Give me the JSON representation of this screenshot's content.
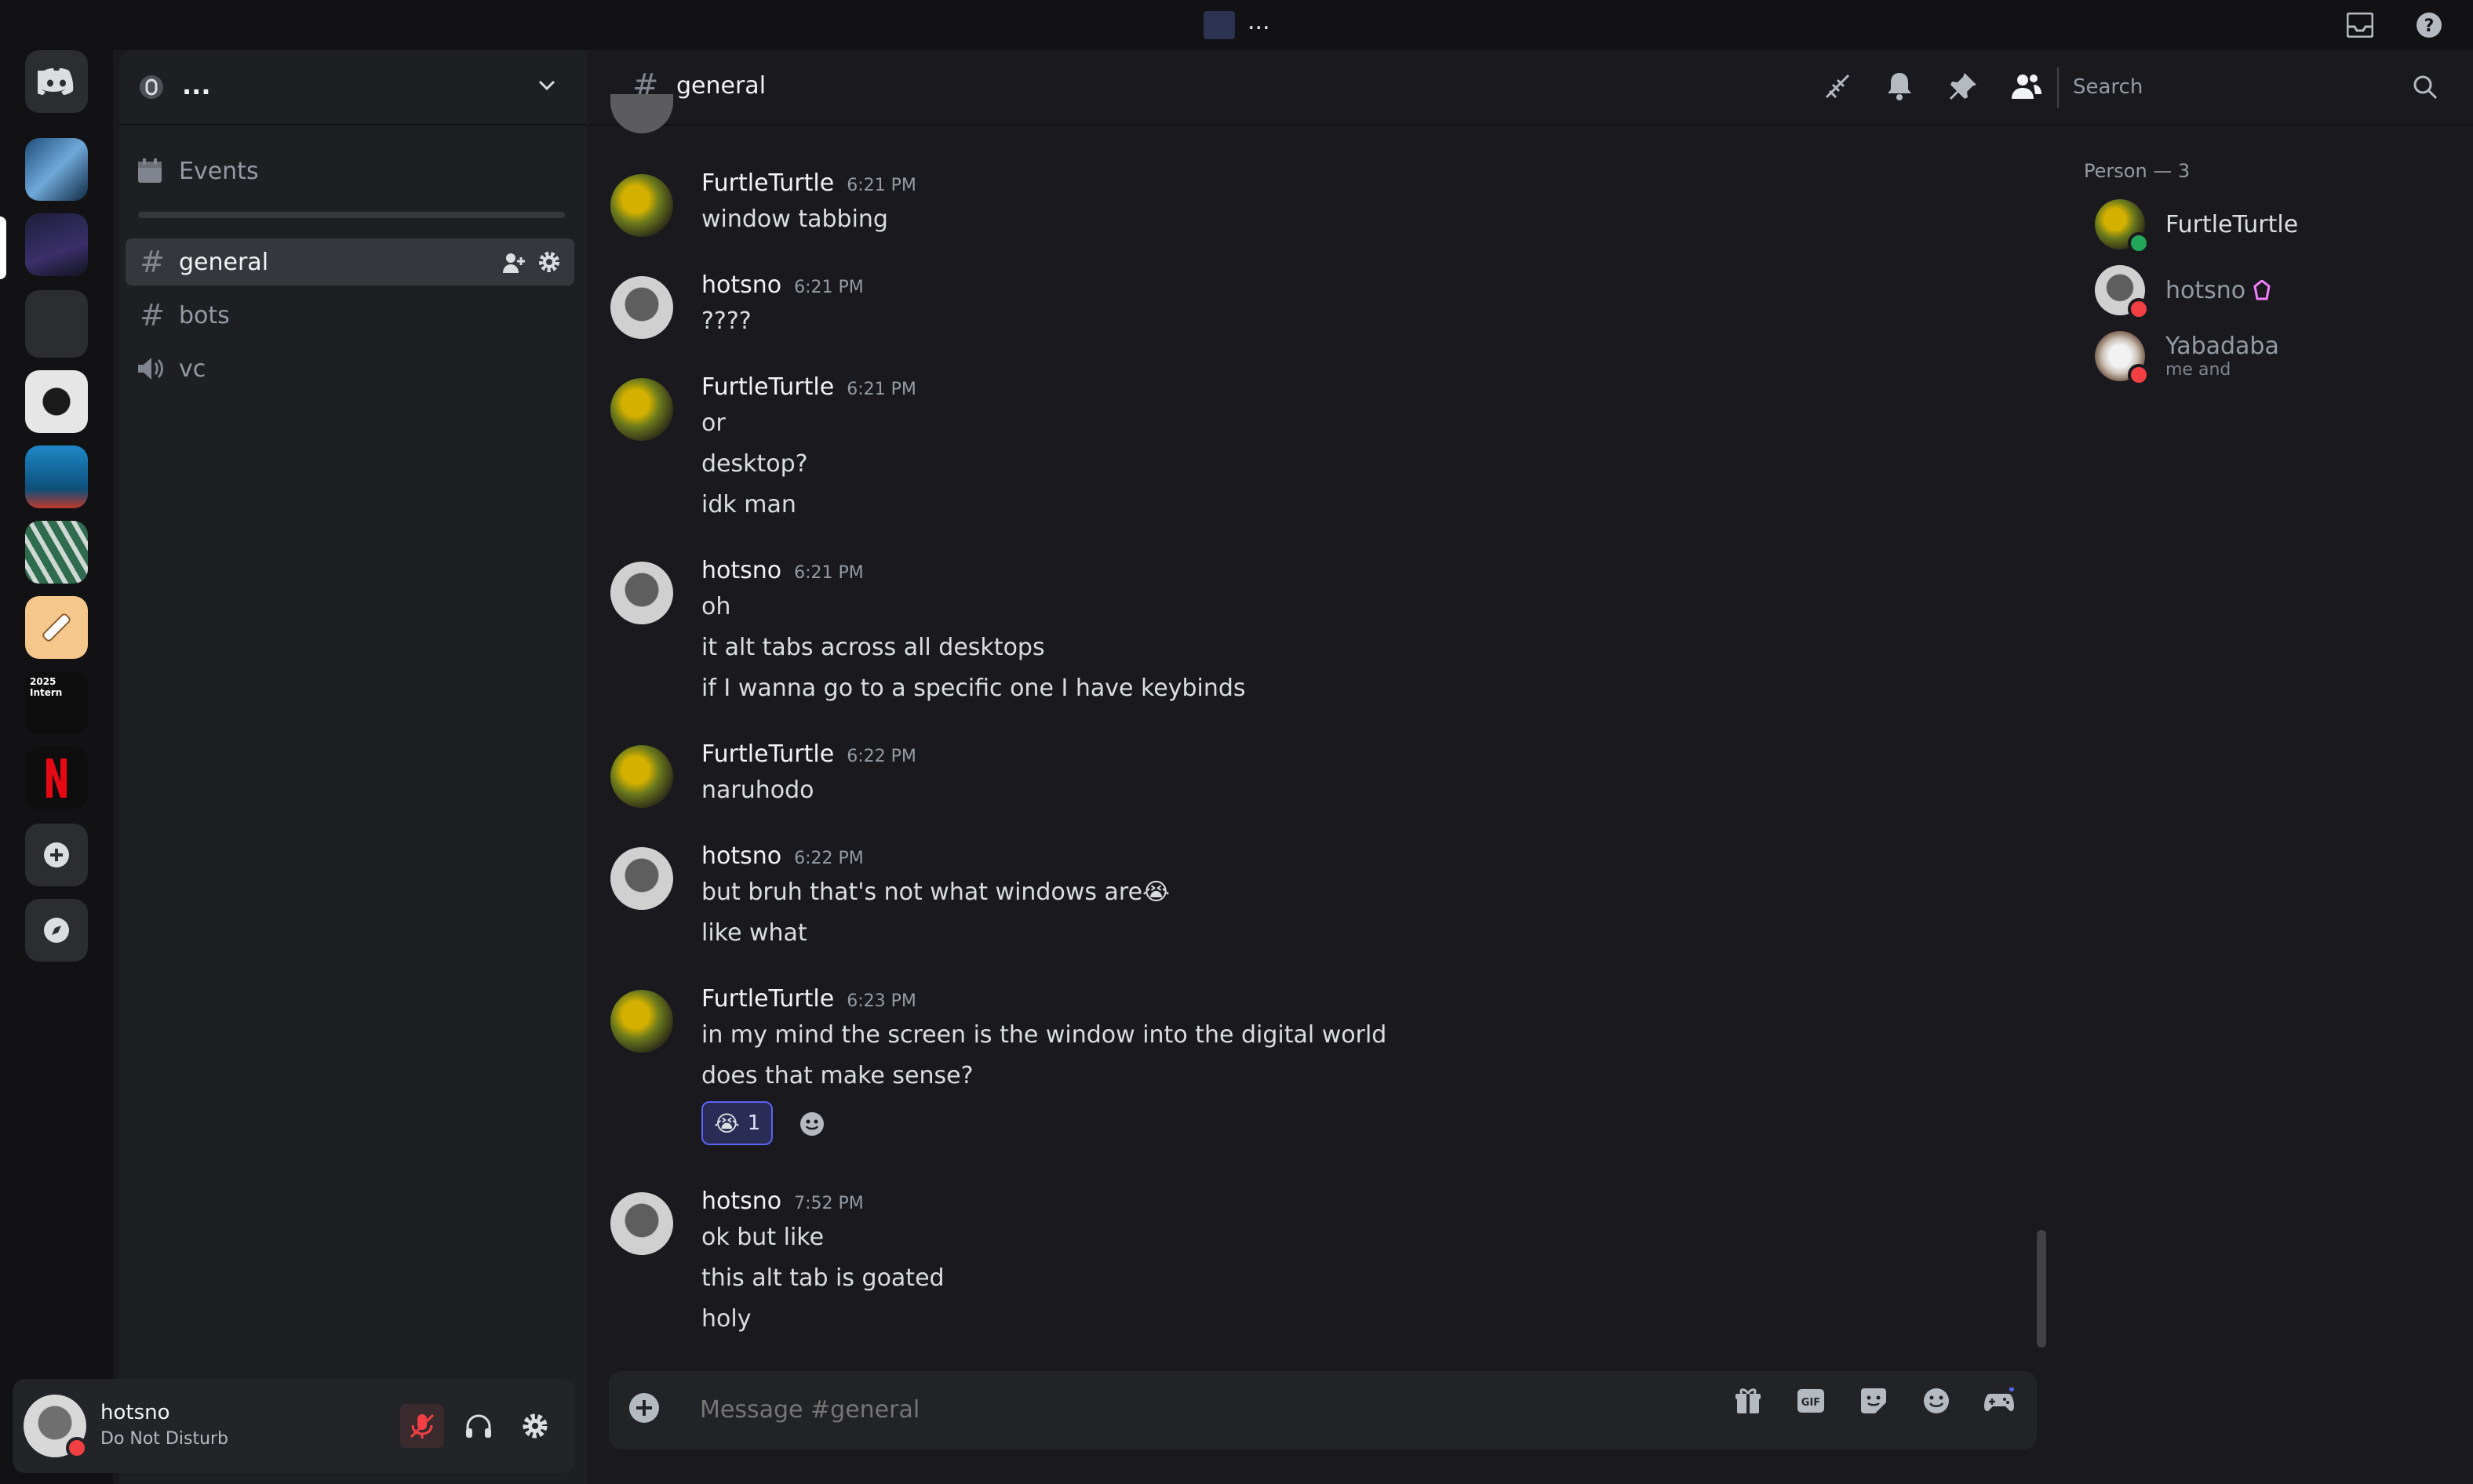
{
  "window": {
    "title": "..."
  },
  "server": {
    "name": "..."
  },
  "sidebar": {
    "events_label": "Events",
    "channels": [
      {
        "name": "general",
        "type": "text",
        "selected": true
      },
      {
        "name": "bots",
        "type": "text",
        "selected": false
      },
      {
        "name": "vc",
        "type": "voice",
        "selected": false
      }
    ]
  },
  "rail": {
    "icons": [
      "discord-home-icon",
      "add-server-icon",
      "discover-icon"
    ],
    "server_badge_text": "2025 Intern"
  },
  "chat_header": {
    "channel": "general",
    "search_placeholder": "Search",
    "icons": [
      "threads-icon",
      "bell-icon",
      "pin-icon",
      "members-icon",
      "search-icon"
    ]
  },
  "messages": [
    {
      "author": "FurtleTurtle",
      "time": "6:21 PM",
      "lines": [
        "window tabbing"
      ]
    },
    {
      "author": "hotsno",
      "time": "6:21 PM",
      "lines": [
        "????"
      ]
    },
    {
      "author": "FurtleTurtle",
      "time": "6:21 PM",
      "lines": [
        "or",
        "desktop?",
        "idk man"
      ]
    },
    {
      "author": "hotsno",
      "time": "6:21 PM",
      "lines": [
        "oh",
        "it alt tabs across all desktops",
        "if I wanna go to a specific one I have keybinds"
      ]
    },
    {
      "author": "FurtleTurtle",
      "time": "6:22 PM",
      "lines": [
        "naruhodo"
      ]
    },
    {
      "author": "hotsno",
      "time": "6:22 PM",
      "lines": [
        "but bruh that's not what windows are",
        "like what"
      ],
      "emoji_after_first": "😭"
    },
    {
      "author": "FurtleTurtle",
      "time": "6:23 PM",
      "lines": [
        "in my mind the screen is the window into the digital world",
        "does that make sense?"
      ],
      "reaction": {
        "emoji": "😭",
        "count": "1"
      }
    },
    {
      "author": "hotsno",
      "time": "7:52 PM",
      "lines": [
        "ok but like",
        "this alt tab is goated",
        "holy"
      ]
    }
  ],
  "members": {
    "header": "Person — 3",
    "list": [
      {
        "name": "FurtleTurtle",
        "status": "online",
        "status_color": "#23a55a"
      },
      {
        "name": "hotsno",
        "status": "dnd",
        "status_color": "#f23f43"
      },
      {
        "name": "Yabadaba",
        "subtext": "me and",
        "status": "dnd",
        "status_color": "#f23f43"
      }
    ]
  },
  "composer": {
    "placeholder": "Message #general",
    "icons": [
      "add-icon",
      "gift-icon",
      "gif-icon",
      "sticker-icon",
      "emoji-icon",
      "activity-icon"
    ]
  },
  "user_panel": {
    "username": "hotsno",
    "status": "Do Not Disturb",
    "status_color": "#f23f43"
  },
  "colors": {
    "accent": "#5865f2",
    "dnd": "#f23f43",
    "online": "#23a55a"
  }
}
